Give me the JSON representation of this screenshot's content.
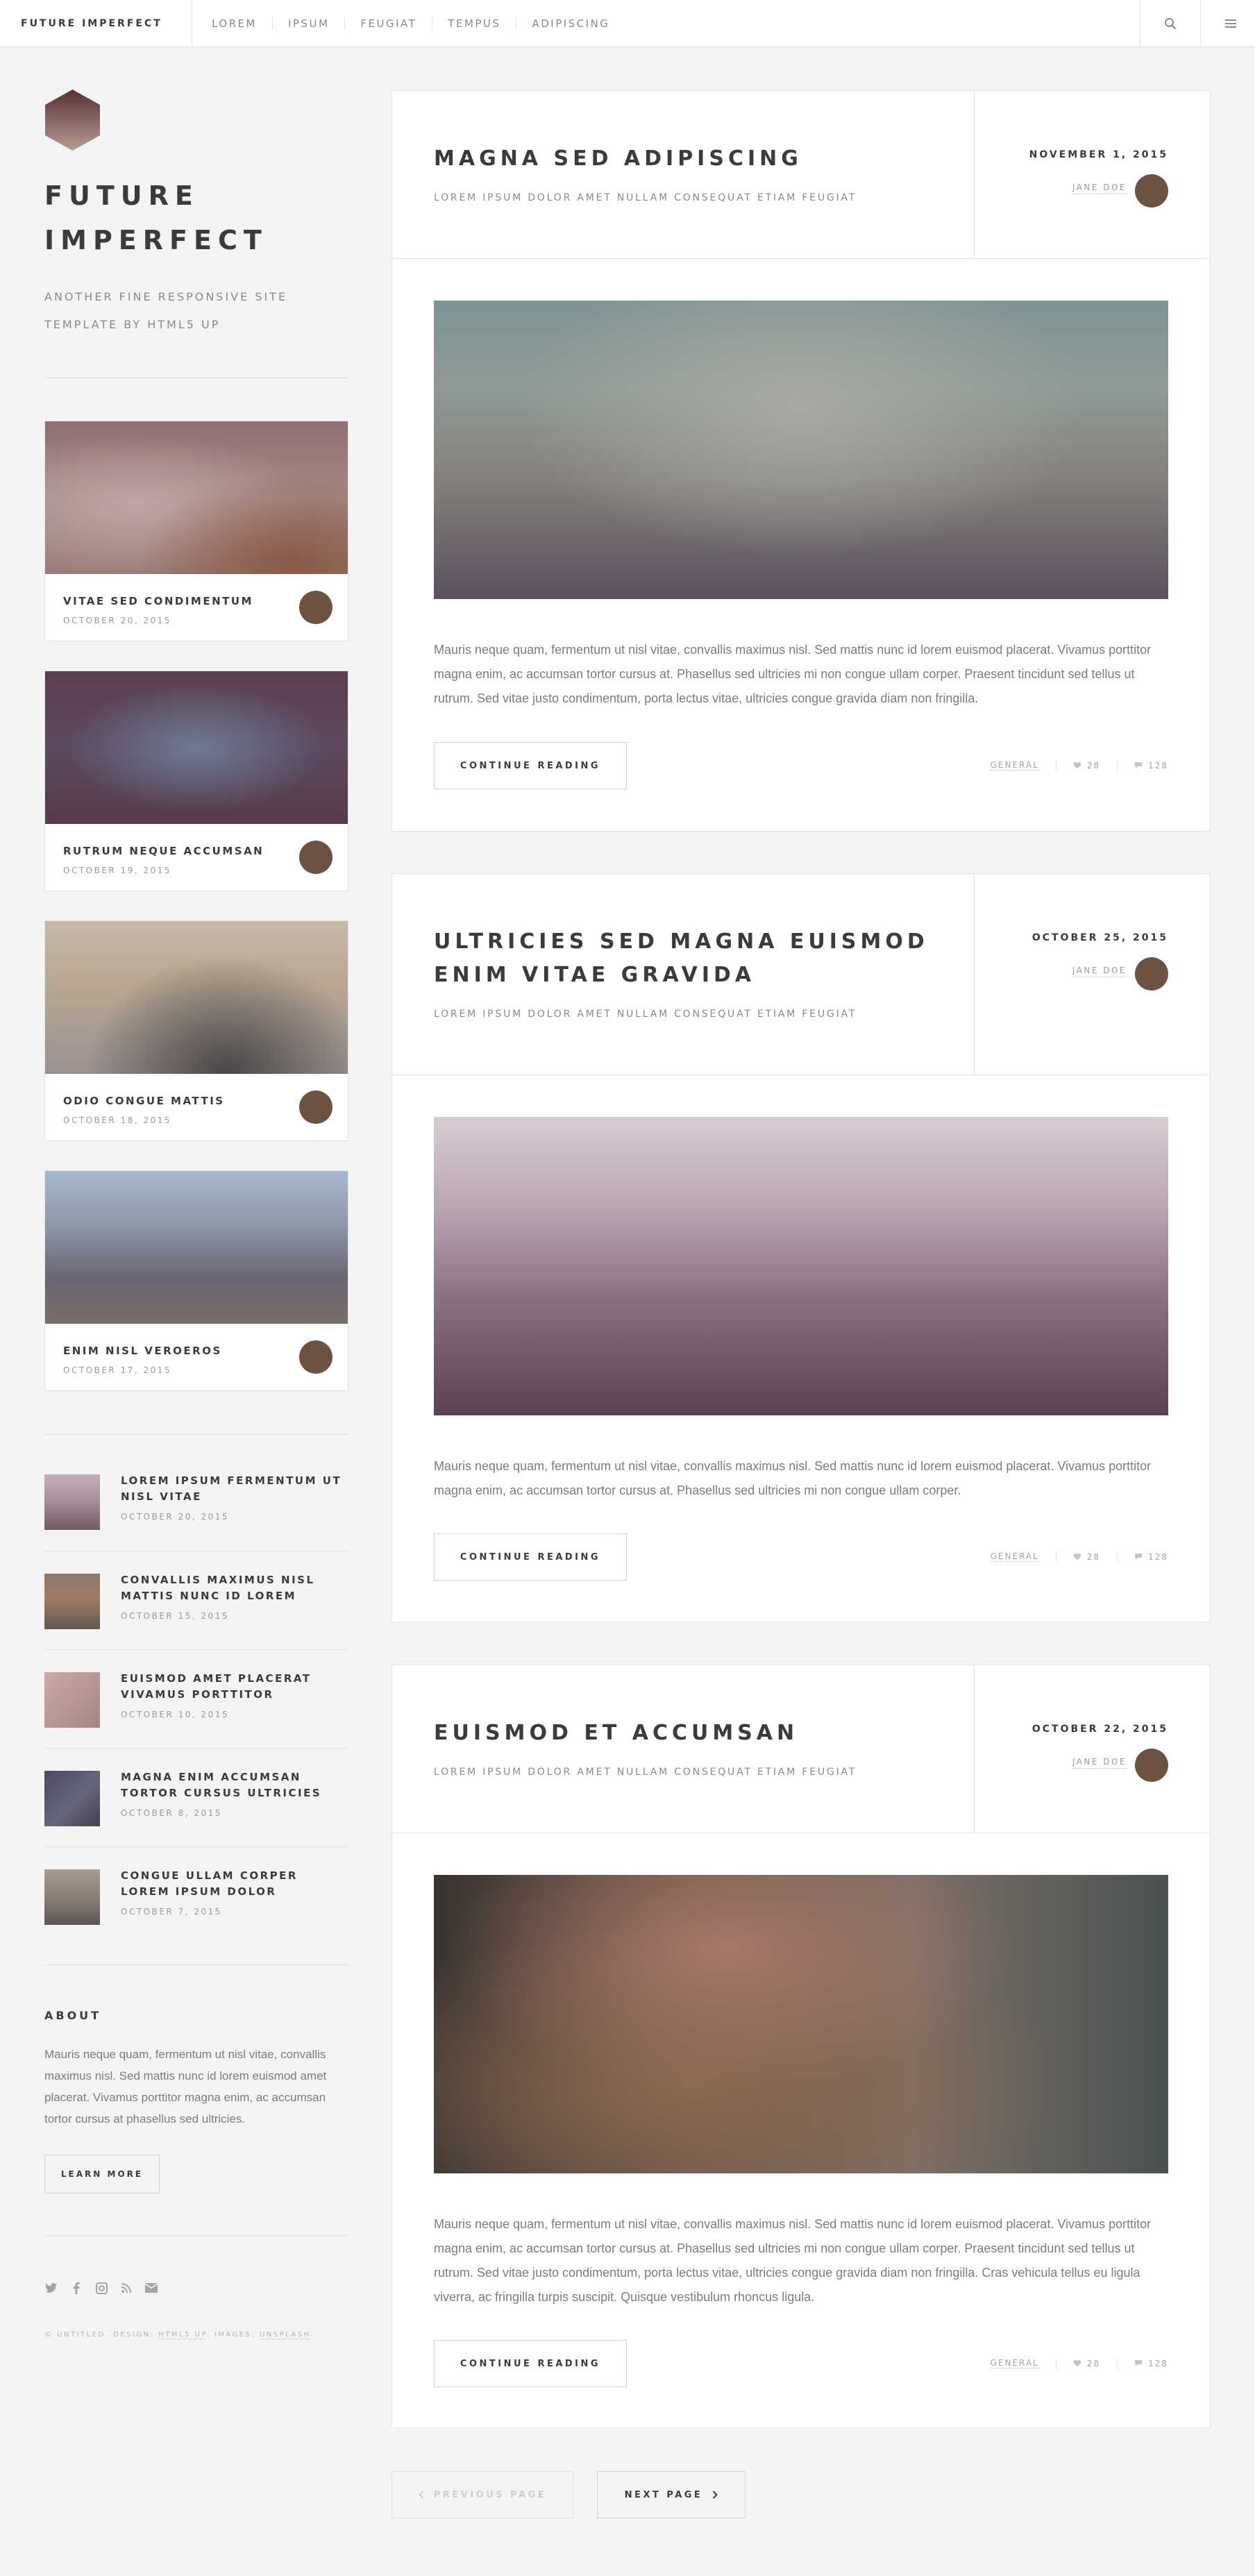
{
  "header": {
    "brand": "FUTURE IMPERFECT",
    "nav": [
      "LOREM",
      "IPSUM",
      "FEUGIAT",
      "TEMPUS",
      "ADIPISCING"
    ],
    "search_icon": "search-icon",
    "menu_icon": "menu-icon"
  },
  "sidebar": {
    "title": "FUTURE IMPERFECT",
    "subtitle": "ANOTHER FINE RESPONSIVE SITE TEMPLATE BY HTML5 UP",
    "mini_posts": [
      {
        "title": "VITAE SED CONDIMENTUM",
        "date": "OCTOBER 20, 2015"
      },
      {
        "title": "RUTRUM NEQUE ACCUMSAN",
        "date": "OCTOBER 19, 2015"
      },
      {
        "title": "ODIO CONGUE MATTIS",
        "date": "OCTOBER 18, 2015"
      },
      {
        "title": "ENIM NISL VEROEROS",
        "date": "OCTOBER 17, 2015"
      }
    ],
    "posts_list": [
      {
        "title": "LOREM IPSUM FERMENTUM UT NISL VITAE",
        "date": "OCTOBER 20, 2015"
      },
      {
        "title": "CONVALLIS MAXIMUS NISL MATTIS NUNC ID LOREM",
        "date": "OCTOBER 15, 2015"
      },
      {
        "title": "EUISMOD AMET PLACERAT VIVAMUS PORTTITOR",
        "date": "OCTOBER 10, 2015"
      },
      {
        "title": "MAGNA ENIM ACCUMSAN TORTOR CURSUS ULTRICIES",
        "date": "OCTOBER 8, 2015"
      },
      {
        "title": "CONGUE ULLAM CORPER LOREM IPSUM DOLOR",
        "date": "OCTOBER 7, 2015"
      }
    ],
    "about": {
      "heading": "ABOUT",
      "text": "Mauris neque quam, fermentum ut nisl vitae, convallis maximus nisl. Sed mattis nunc id lorem euismod amet placerat. Vivamus porttitor magna enim, ac accumsan tortor cursus at phasellus sed ultricies.",
      "button": "LEARN MORE"
    },
    "social_icons": [
      "twitter-icon",
      "facebook-icon",
      "instagram-icon",
      "rss-icon",
      "email-icon"
    ],
    "copyright": {
      "prefix": "© UNTITLED. DESIGN: ",
      "design": "HTML5 UP",
      "mid": ". IMAGES: ",
      "images": "UNSPLASH",
      "suffix": "."
    }
  },
  "posts": [
    {
      "title": "MAGNA SED ADIPISCING",
      "subtitle": "LOREM IPSUM DOLOR AMET NULLAM CONSEQUAT ETIAM FEUGIAT",
      "date": "NOVEMBER 1, 2015",
      "author": "JANE DOE",
      "body": "Mauris neque quam, fermentum ut nisl vitae, convallis maximus nisl. Sed mattis nunc id lorem euismod placerat. Vivamus porttitor magna enim, ac accumsan tortor cursus at. Phasellus sed ultricies mi non congue ullam corper. Praesent tincidunt sed tellus ut rutrum. Sed vitae justo condimentum, porta lectus vitae, ultricies congue gravida diam non fringilla.",
      "button": "CONTINUE READING",
      "category": "GENERAL",
      "likes": "28",
      "comments": "128"
    },
    {
      "title": "ULTRICIES SED MAGNA EUISMOD ENIM VITAE GRAVIDA",
      "subtitle": "LOREM IPSUM DOLOR AMET NULLAM CONSEQUAT ETIAM FEUGIAT",
      "date": "OCTOBER 25, 2015",
      "author": "JANE DOE",
      "body": "Mauris neque quam, fermentum ut nisl vitae, convallis maximus nisl. Sed mattis nunc id lorem euismod placerat. Vivamus porttitor magna enim, ac accumsan tortor cursus at. Phasellus sed ultricies mi non congue ullam corper.",
      "button": "CONTINUE READING",
      "category": "GENERAL",
      "likes": "28",
      "comments": "128"
    },
    {
      "title": "EUISMOD ET ACCUMSAN",
      "subtitle": "LOREM IPSUM DOLOR AMET NULLAM CONSEQUAT ETIAM FEUGIAT",
      "date": "OCTOBER 22, 2015",
      "author": "JANE DOE",
      "body": "Mauris neque quam, fermentum ut nisl vitae, convallis maximus nisl. Sed mattis nunc id lorem euismod placerat. Vivamus porttitor magna enim, ac accumsan tortor cursus at. Phasellus sed ultricies mi non congue ullam corper. Praesent tincidunt sed tellus ut rutrum. Sed vitae justo condimentum, porta lectus vitae, ultricies congue gravida diam non fringilla. Cras vehicula tellus eu ligula viverra, ac fringilla turpis suscipit. Quisque vestibulum rhoncus ligula.",
      "button": "CONTINUE READING",
      "category": "GENERAL",
      "likes": "28",
      "comments": "128"
    }
  ],
  "pagination": {
    "prev": "PREVIOUS PAGE",
    "next": "NEXT PAGE"
  },
  "colors": {
    "background": "#f4f4f4",
    "text": "#3c3b3b",
    "muted": "#8a8a8a",
    "avatar": "#6b5241"
  }
}
